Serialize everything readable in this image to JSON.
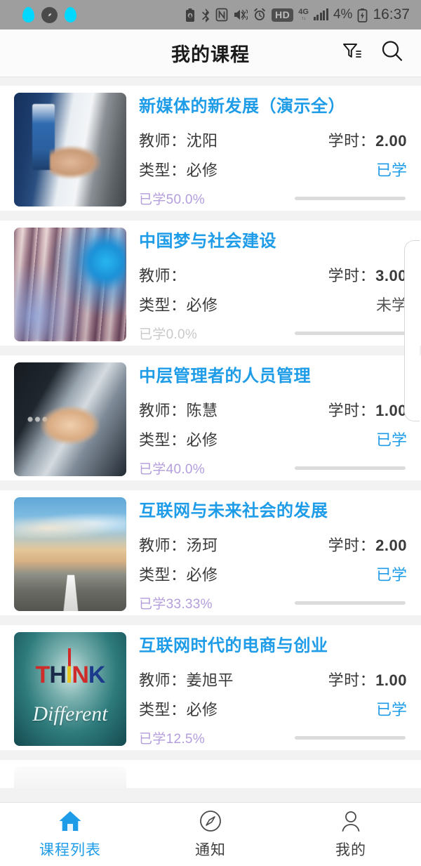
{
  "status_bar": {
    "left_icons": [
      "water-drop-icon",
      "compass-dark-icon",
      "water-drop-icon"
    ],
    "right_icons": [
      "battery-saver-icon",
      "bluetooth-icon",
      "nfc-icon",
      "mute-vibrate-icon",
      "alarm-icon"
    ],
    "hd_badge": "HD",
    "network": "4G",
    "network_sub": "↑↓",
    "battery_percent": "4%",
    "battery_icon": "battery-charging-icon",
    "time": "16:37",
    "background_color": "#9e9e9e"
  },
  "header": {
    "title": "我的课程",
    "filter_icon": "filter-icon",
    "search_icon": "search-icon"
  },
  "labels": {
    "teacher_prefix": "教师：",
    "hours_prefix": "学时：",
    "type_prefix": "类型：",
    "progress_prefix": "已学"
  },
  "colors": {
    "accent_blue": "#1e9ce8",
    "progress_blue": "#1e93d8",
    "progress_track": "#dcdcdc",
    "percent_purple": "#b39ddb",
    "percent_gray": "#c9c9c9"
  },
  "courses": [
    {
      "title": "新媒体的新发展（演示全）",
      "teacher": "教师：沈阳",
      "hours_label": "学时：",
      "hours": "2.00",
      "type": "类型：必修",
      "status": "已学",
      "status_state": "learned",
      "percent_text": "已学50.0%",
      "percent": 50.0,
      "thumb": "business-handshake-blue-suit"
    },
    {
      "title": "中国梦与社会建设",
      "teacher": "教师：",
      "hours_label": "学时：",
      "hours": "3.00",
      "type": "类型：必修",
      "status": "未学",
      "status_state": "unlearned",
      "percent_text": "已学0.0%",
      "percent": 0.0,
      "thumb": "colorful-blur-swirl"
    },
    {
      "title": "中层管理者的人员管理",
      "teacher": "教师：陈慧",
      "hours_label": "学时：",
      "hours": "1.00",
      "type": "类型：必修",
      "status": "已学",
      "status_state": "learned",
      "percent_text": "已学40.0%",
      "percent": 40.0,
      "thumb": "dark-suit-handshake"
    },
    {
      "title": "互联网与未来社会的发展",
      "teacher": "教师：汤珂",
      "hours_label": "学时：",
      "hours": "2.00",
      "type": "类型：必修",
      "status": "已学",
      "status_state": "learned",
      "percent_text": "已学33.33%",
      "percent": 33.33,
      "thumb": "road-sunset"
    },
    {
      "title": "互联网时代的电商与创业",
      "teacher": "教师：姜旭平",
      "hours_label": "学时：",
      "hours": "1.00",
      "type": "类型：必修",
      "status": "已学",
      "status_state": "learned",
      "percent_text": "已学12.5%",
      "percent": 12.5,
      "thumb": "think-different-teal"
    }
  ],
  "bottom_nav": [
    {
      "label": "课程列表",
      "icon": "home-icon",
      "active": true
    },
    {
      "label": "通知",
      "icon": "compass-icon",
      "active": false
    },
    {
      "label": "我的",
      "icon": "person-icon",
      "active": false
    }
  ]
}
